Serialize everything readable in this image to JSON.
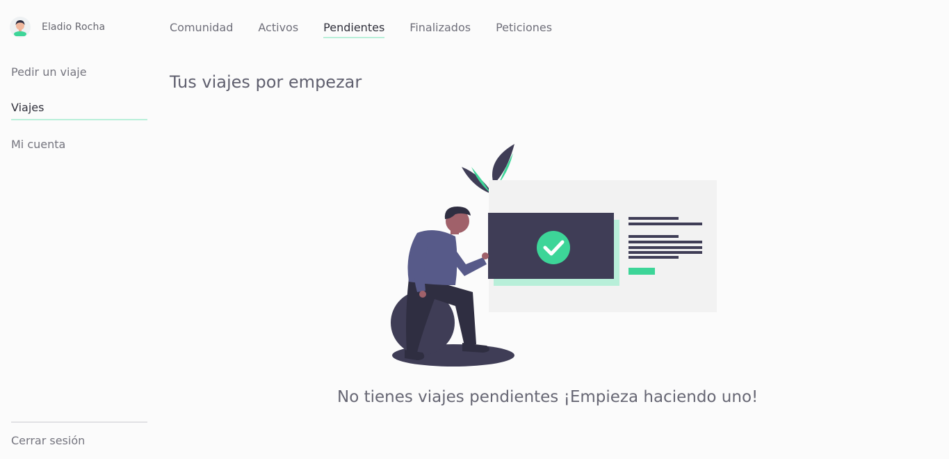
{
  "user": {
    "name": "Eladio Rocha",
    "avatar_icon": "user-avatar-icon"
  },
  "sidebar": {
    "items": [
      {
        "label": "Pedir un viaje"
      },
      {
        "label": "Viajes"
      },
      {
        "label": "Mi cuenta"
      }
    ],
    "active_index": 1,
    "logout_label": "Cerrar sesión"
  },
  "tabs": {
    "items": [
      {
        "label": "Comunidad"
      },
      {
        "label": "Activos"
      },
      {
        "label": "Pendientes"
      },
      {
        "label": "Finalizados"
      },
      {
        "label": "Peticiones"
      }
    ],
    "active_index": 2
  },
  "main": {
    "title": "Tus viajes por empezar",
    "empty_message": "No tienes viajes pendientes ¡Empieza haciendo uno!",
    "illustration_icon": "empty-state-illustration"
  },
  "colors": {
    "accent": "#3dd598",
    "accent_light": "#b8efd9",
    "dark": "#3f3d56",
    "text": "#6b6b78"
  }
}
